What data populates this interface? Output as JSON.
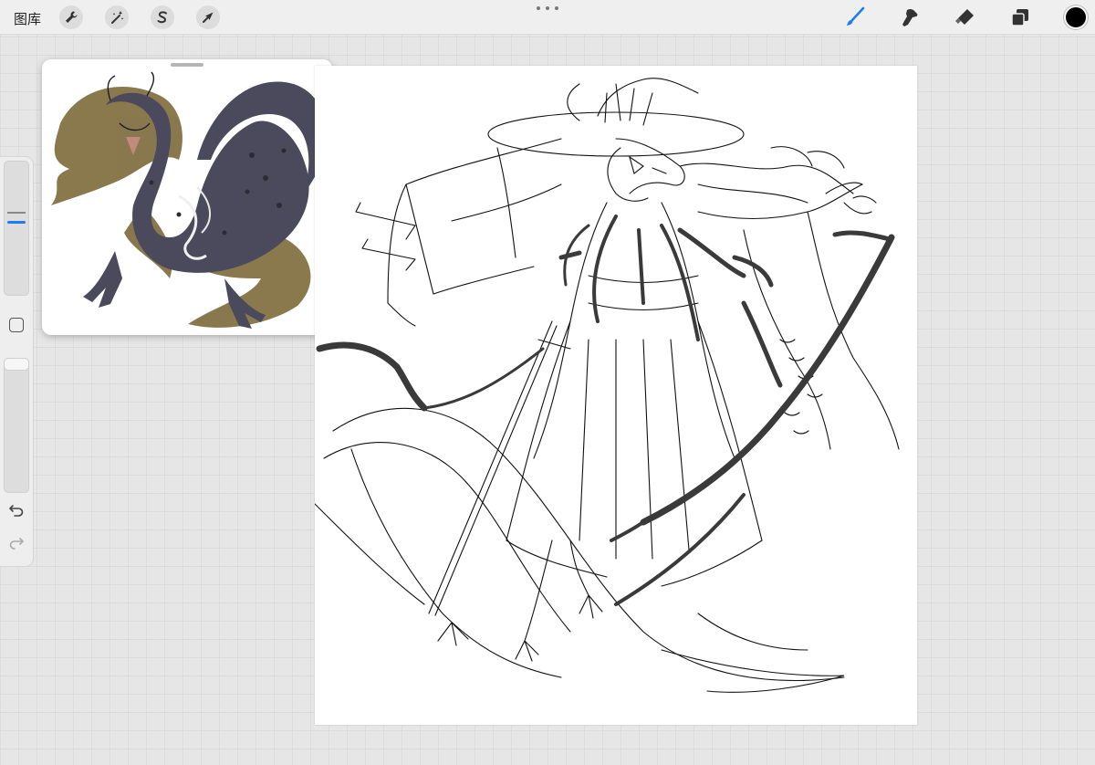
{
  "topbar": {
    "gallery_label": "图库",
    "actions_icon": "wrench-icon",
    "adjustments_icon": "magic-wand-icon",
    "selection_icon": "selection-s-icon",
    "transform_icon": "arrow-cursor-icon",
    "more_icon": "three-dots-icon",
    "tools": [
      "brush-icon",
      "smudge-icon",
      "eraser-icon",
      "layers-icon"
    ],
    "active_tool": "brush-icon",
    "accent_color": "#1e7cf7",
    "current_color": "#000000"
  },
  "sidebar": {
    "icons": [
      "brush-size-slider",
      "modify-square-icon",
      "opacity-slider",
      "undo-icon",
      "redo-icon"
    ]
  },
  "reference": {
    "image": "dragon-color-reference",
    "colors": {
      "body": "#4a4a5c",
      "mane": "#7d6a3a"
    }
  },
  "canvas": {
    "background": "#ffffff",
    "subject": "dragon-warrior-line-sketch"
  }
}
